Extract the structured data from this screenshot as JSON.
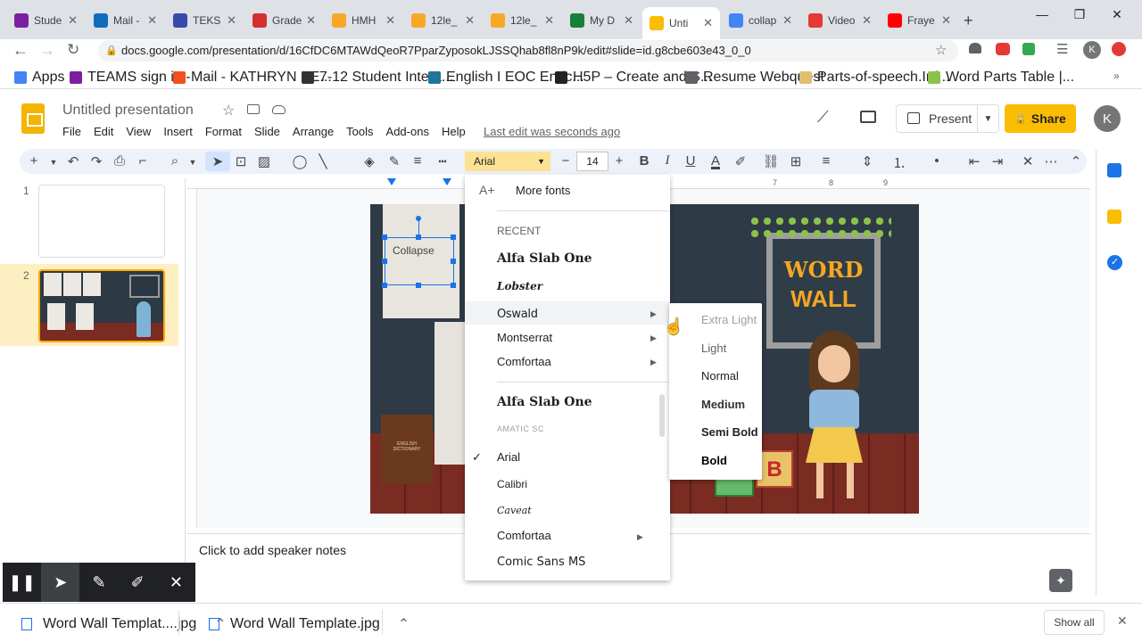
{
  "browser": {
    "tabs": [
      {
        "label": "Stude",
        "color": "#7b1fa2"
      },
      {
        "label": "Mail -",
        "color": "#0f6cbd"
      },
      {
        "label": "TEKS",
        "color": "#3949ab"
      },
      {
        "label": "Grade",
        "color": "#d32f2f"
      },
      {
        "label": "HMH",
        "color": "#f9a825"
      },
      {
        "label": "12le_",
        "color": "#f9a825"
      },
      {
        "label": "12le_",
        "color": "#f9a825"
      },
      {
        "label": "My D",
        "color": "#188038"
      },
      {
        "label": "Unti",
        "color": "#fbbc04"
      },
      {
        "label": "collap",
        "color": "#4285f4"
      },
      {
        "label": "Video",
        "color": "#e53935"
      },
      {
        "label": "Fraye",
        "color": "#ff0000"
      }
    ],
    "url": "docs.google.com/presentation/d/16CfDC6MTAWdQeoR7PparZyposokLJSSQhab8fl8nP9k/edit#slide=id.g8cbe603e43_0_0",
    "bookmarks": [
      {
        "label": "Apps",
        "color": "#4285f4"
      },
      {
        "label": "TEAMS sign in -",
        "color": "#7b1fa2"
      },
      {
        "label": "Mail - KATHRYN BE...",
        "color": "#f25022"
      },
      {
        "label": "7-12 Student Intera...",
        "color": "#333333"
      },
      {
        "label": "English I EOC Enric...",
        "color": "#21759b"
      },
      {
        "label": "H5P – Create and S...",
        "color": "#222222"
      },
      {
        "label": "Resume Webquest",
        "color": "#5f6368"
      },
      {
        "label": "Parts-of-speech.Inf...",
        "color": "#e0c070"
      },
      {
        "label": "Word Parts Table |...",
        "color": "#8bc34a"
      }
    ]
  },
  "docs": {
    "title": "Untitled presentation",
    "menu": [
      "File",
      "Edit",
      "View",
      "Insert",
      "Format",
      "Slide",
      "Arrange",
      "Tools",
      "Add-ons",
      "Help"
    ],
    "last_edit": "Last edit was seconds ago",
    "present_label": "Present",
    "share_label": "Share",
    "avatar_letter": "K"
  },
  "toolbar": {
    "font": "Arial",
    "font_size": "14"
  },
  "filmstrip": {
    "slides": [
      "1",
      "2"
    ]
  },
  "slide": {
    "textbox": "Collapse",
    "word_wall_line1": "WORD",
    "word_wall_line2": "WALL",
    "book_label": "ENGLISH DICTIONARY",
    "block_b": "B"
  },
  "notes": "Click to add speaker notes",
  "font_menu": {
    "more_fonts": "More fonts",
    "recent_header": "RECENT",
    "recent": [
      "Alfa Slab One",
      "Lobster",
      "Oswald",
      "Montserrat",
      "Comfortaa"
    ],
    "all": [
      "Alfa Slab One",
      "AMATIC SC",
      "Arial",
      "Calibri",
      "Caveat",
      "Comfortaa",
      "Comic Sans MS"
    ],
    "selected": "Arial"
  },
  "weights_menu": [
    "Extra Light",
    "Light",
    "Normal",
    "Medium",
    "Semi Bold",
    "Bold"
  ],
  "downloads": [
    {
      "label": "Word Wall Templat....jpg"
    },
    {
      "label": "Word Wall Template.jpg"
    }
  ],
  "show_all": "Show all"
}
